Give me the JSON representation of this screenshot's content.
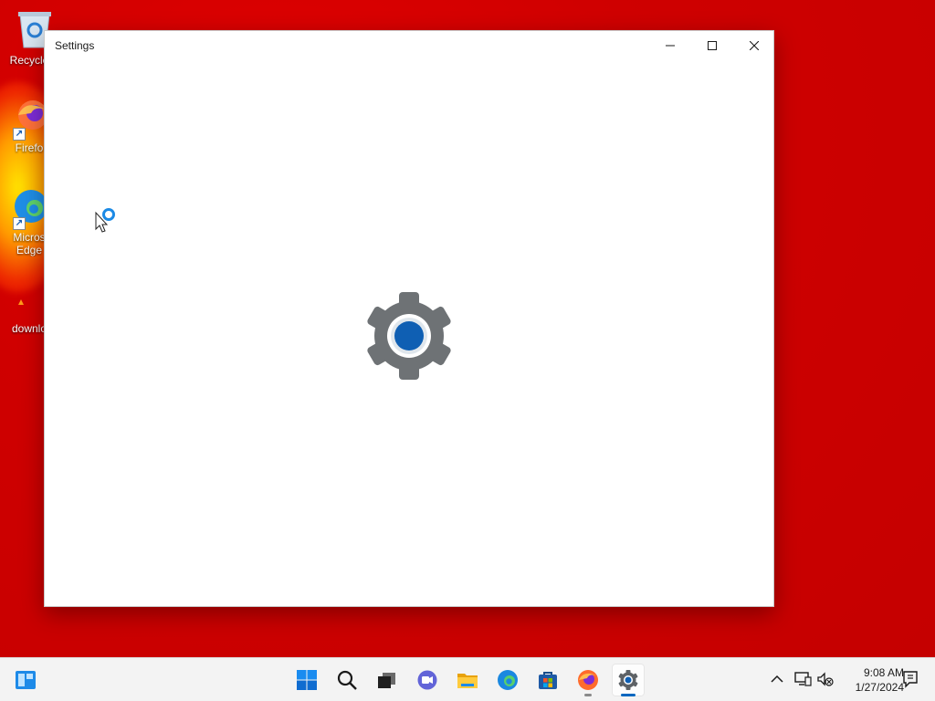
{
  "desktop": {
    "icons": [
      {
        "label": "Recycle",
        "icon": "recycle-bin-icon"
      },
      {
        "label": "Firefo",
        "icon": "firefox-icon"
      },
      {
        "label": "Micros\nEdge",
        "icon": "edge-icon"
      },
      {
        "label": "downlo",
        "icon": "download-file-icon"
      }
    ]
  },
  "window": {
    "title": "Settings",
    "controls": {
      "minimize": "minimize-icon",
      "maximize": "maximize-icon",
      "close": "close-icon"
    },
    "splash_icon": "settings-gear-icon"
  },
  "cursor": "busy-pointer-icon",
  "taskbar": {
    "items": [
      "start-icon",
      "search-icon",
      "task-view-icon",
      "chat-icon",
      "file-explorer-icon",
      "edge-icon",
      "store-icon",
      "firefox-icon",
      "settings-icon"
    ],
    "tray": [
      "chevron-up-icon",
      "network-icon",
      "volume-mute-icon",
      "notification-icon"
    ],
    "time": "9:08 AM",
    "date": "1/27/2024",
    "accent": "#0067c0"
  }
}
